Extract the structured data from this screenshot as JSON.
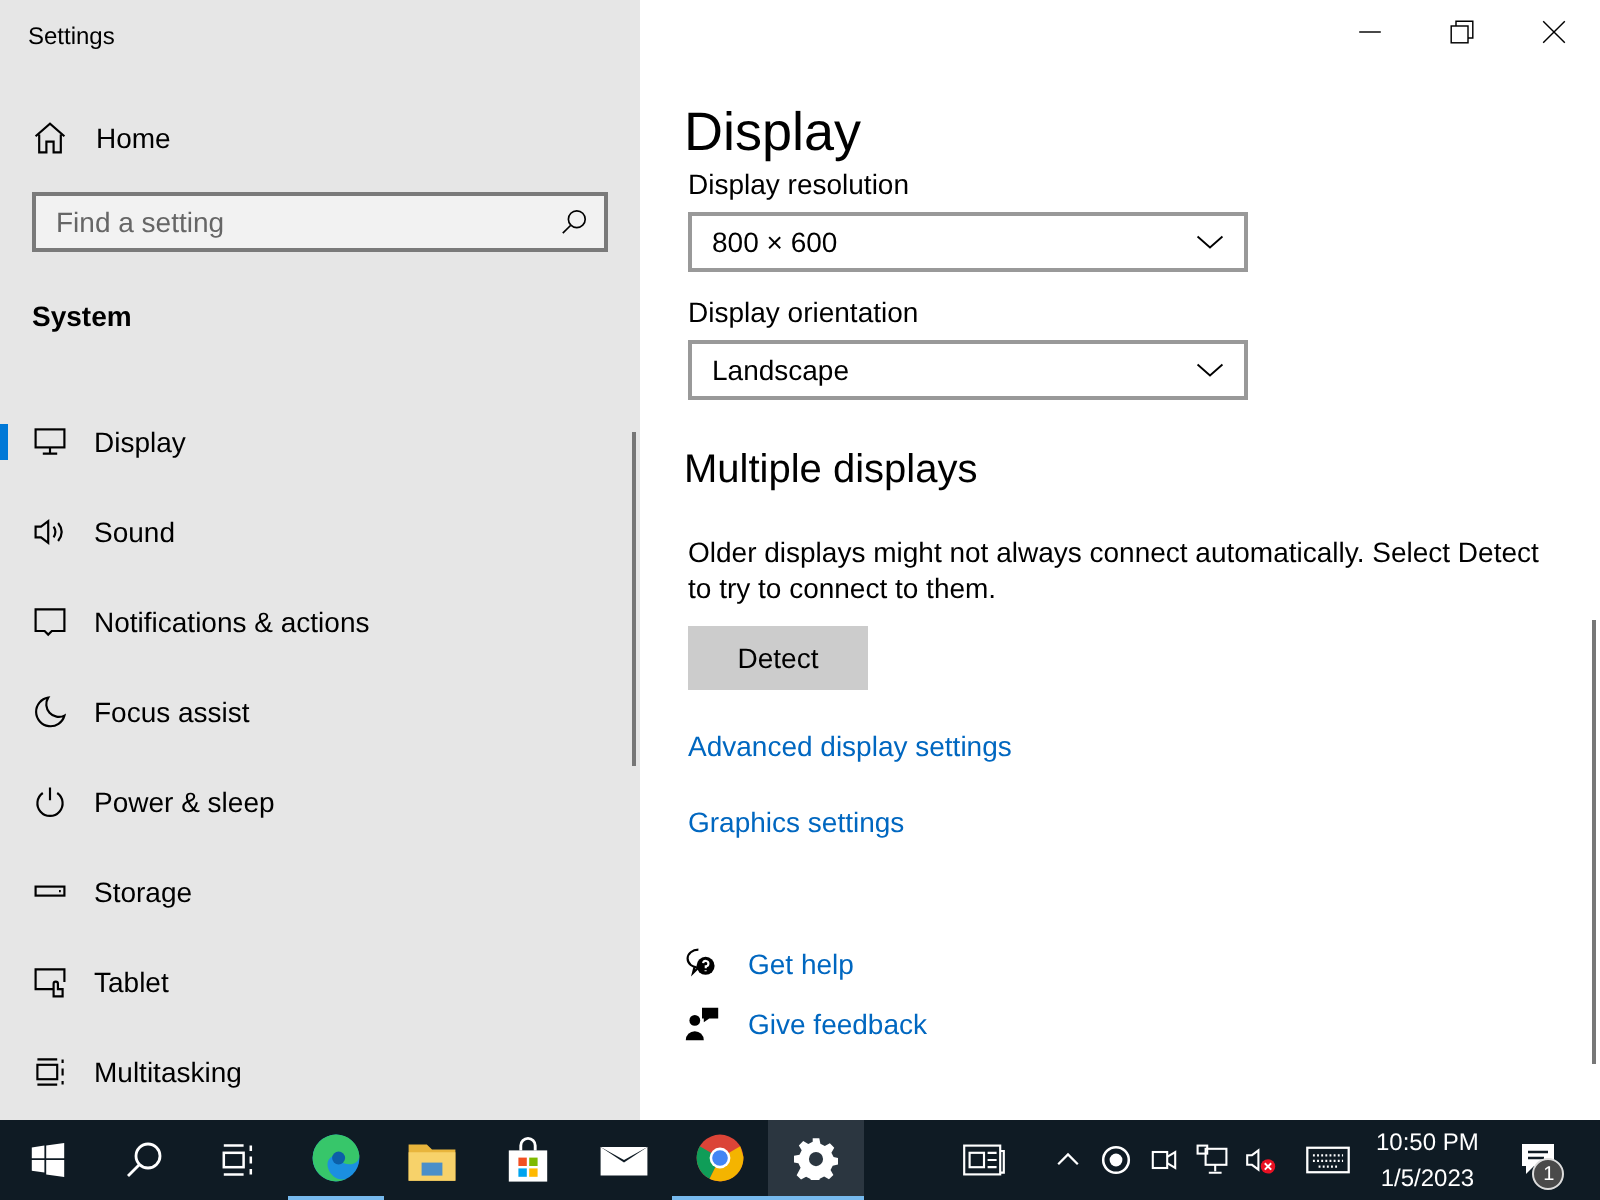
{
  "window": {
    "title": "Settings",
    "controls": [
      {
        "kind": "minimize"
      },
      {
        "kind": "restore"
      },
      {
        "kind": "close"
      }
    ]
  },
  "sidebar": {
    "home": "Home",
    "search": {
      "placeholder": "Find a setting"
    },
    "section": "System",
    "items": [
      {
        "label": "Display",
        "kind": "display",
        "selected": true
      },
      {
        "label": "Sound",
        "kind": "sound",
        "selected": false
      },
      {
        "label": "Notifications & actions",
        "kind": "notifications",
        "selected": false
      },
      {
        "label": "Focus assist",
        "kind": "moon",
        "selected": false
      },
      {
        "label": "Power & sleep",
        "kind": "power",
        "selected": false
      },
      {
        "label": "Storage",
        "kind": "storage",
        "selected": false
      },
      {
        "label": "Tablet",
        "kind": "tablet",
        "selected": false
      },
      {
        "label": "Multitasking",
        "kind": "multitasking",
        "selected": false
      }
    ]
  },
  "main": {
    "title": "Display",
    "settings": [
      {
        "label": "Display resolution",
        "value": "800 × 600"
      },
      {
        "label": "Display orientation",
        "value": "Landscape"
      }
    ],
    "section": {
      "title": "Multiple displays",
      "text": "Older displays might not always connect automatically. Select Detect to try to connect to them.",
      "button": "Detect"
    },
    "links": [
      "Advanced display settings",
      "Graphics settings"
    ],
    "help_links": [
      {
        "kind": "help",
        "label": "Get help"
      },
      {
        "kind": "feedback",
        "label": "Give feedback"
      }
    ]
  },
  "taskbar": {
    "buttons": [
      {
        "kind": "start"
      },
      {
        "kind": "search"
      },
      {
        "kind": "taskview"
      }
    ],
    "apps": [
      {
        "kind": "edge",
        "running": true,
        "selected": false
      },
      {
        "kind": "explorer",
        "running": false,
        "selected": false
      },
      {
        "kind": "store",
        "running": false,
        "selected": false
      },
      {
        "kind": "mail",
        "running": false,
        "selected": false
      },
      {
        "kind": "chrome",
        "running": true,
        "selected": false
      },
      {
        "kind": "settings",
        "running": true,
        "selected": true
      }
    ],
    "tray": [
      {
        "kind": "news"
      },
      {
        "kind": "chevron"
      },
      {
        "kind": "record"
      },
      {
        "kind": "camera"
      },
      {
        "kind": "network"
      },
      {
        "kind": "volume-muted"
      },
      {
        "kind": "keyboard"
      }
    ],
    "time": "10:50 PM",
    "date": "1/5/2023",
    "notifications": {
      "badge": "1"
    }
  }
}
